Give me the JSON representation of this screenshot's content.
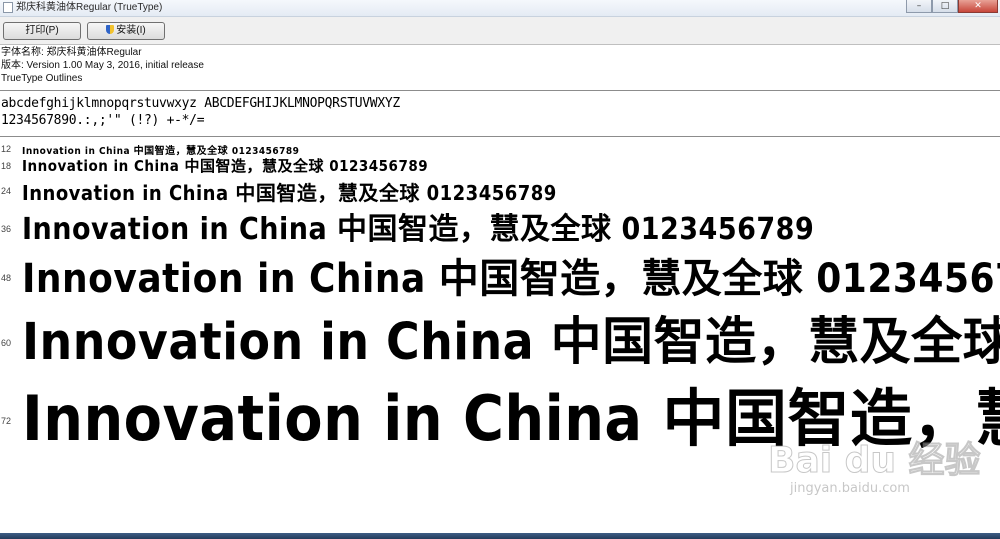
{
  "window": {
    "title": "郑庆科黄油体Regular (TrueType)",
    "controls": {
      "minimize": "–",
      "maximize": "□",
      "close": "✕"
    }
  },
  "toolbar": {
    "print_label": "打印(P)",
    "install_label": "安装(I)"
  },
  "font_info": {
    "name_line": "字体名称: 郑庆科黄油体Regular",
    "version_line": "版本: Version 1.00 May 3, 2016, initial release",
    "outline_line": "TrueType Outlines"
  },
  "charset": {
    "line1": "abcdefghijklmnopqrstuvwxyz ABCDEFGHIJKLMNOPQRSTUVWXYZ",
    "line2": "1234567890.:,;'\" (!?) +-*/="
  },
  "sample_text": "Innovation in China 中国智造，慧及全球 0123456789",
  "samples": [
    {
      "size": "12"
    },
    {
      "size": "18"
    },
    {
      "size": "24"
    },
    {
      "size": "36"
    },
    {
      "size": "48"
    },
    {
      "size": "60"
    },
    {
      "size": "72"
    }
  ],
  "watermark": {
    "logo": "Bai du 经验",
    "url": "jingyan.baidu.com"
  },
  "colors": {
    "titlebar": "#e4ebf4",
    "toolbar": "#f0f0f0",
    "close_button": "#c7463a",
    "text": "#000000"
  }
}
